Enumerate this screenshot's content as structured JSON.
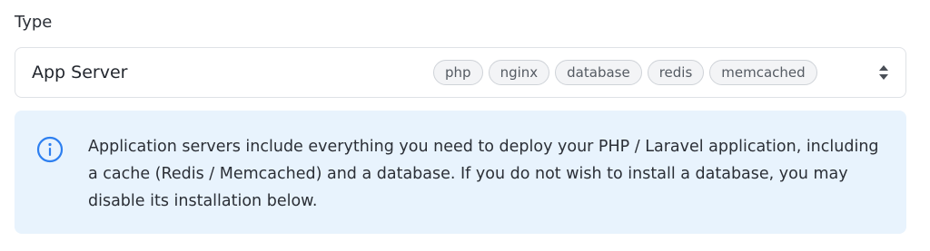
{
  "field": {
    "label": "Type"
  },
  "select": {
    "value": "App Server",
    "tags": [
      "php",
      "nginx",
      "database",
      "redis",
      "memcached"
    ],
    "chevron_icon": "chevron-up-down-icon"
  },
  "info": {
    "icon": "info-circle-icon",
    "text": "Application servers include everything you need to deploy your PHP / Laravel application, including a cache (Redis / Memcached) and a database. If you do not wish to install a database, you may disable its installation below."
  },
  "colors": {
    "info_background": "#e8f3fd",
    "info_icon": "#2d7ff0",
    "tag_background": "#f3f4f6",
    "border": "#dfe2e6"
  }
}
